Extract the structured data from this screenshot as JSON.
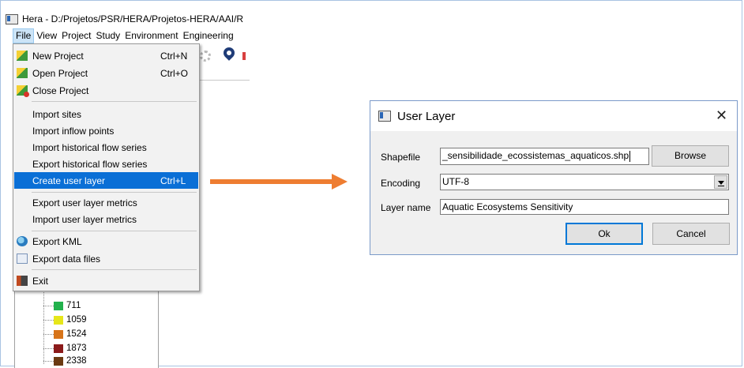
{
  "window": {
    "title": "Hera - D:/Projetos/PSR/HERA/Projetos-HERA/AAI/R"
  },
  "menubar": {
    "items": [
      "File",
      "View",
      "Project",
      "Study",
      "Environment",
      "Engineering"
    ]
  },
  "file_menu": {
    "items": [
      {
        "label": "New Project",
        "shortcut": "Ctrl+N",
        "icon": "new-project-icon"
      },
      {
        "label": "Open Project",
        "shortcut": "Ctrl+O",
        "icon": "open-project-icon"
      },
      {
        "label": "Close Project",
        "shortcut": "",
        "icon": "close-project-icon"
      },
      {
        "label": "Import sites",
        "shortcut": ""
      },
      {
        "label": "Import inflow points",
        "shortcut": ""
      },
      {
        "label": "Import historical flow series",
        "shortcut": ""
      },
      {
        "label": "Export historical flow series",
        "shortcut": ""
      },
      {
        "label": "Create user layer",
        "shortcut": "Ctrl+L",
        "highlighted": true
      },
      {
        "label": "Export user layer metrics",
        "shortcut": ""
      },
      {
        "label": "Import user layer metrics",
        "shortcut": ""
      },
      {
        "label": "Export KML",
        "shortcut": "",
        "icon": "globe-icon"
      },
      {
        "label": "Export data files",
        "shortcut": "",
        "icon": "export-files-icon"
      },
      {
        "label": "Exit",
        "shortcut": "",
        "icon": "exit-icon"
      }
    ]
  },
  "legend": {
    "items": [
      {
        "label": "711",
        "color": "#22b14c"
      },
      {
        "label": "1059",
        "color": "#e6e61a"
      },
      {
        "label": "1524",
        "color": "#d7741a"
      },
      {
        "label": "1873",
        "color": "#8b1a1a"
      },
      {
        "label": "2338",
        "color": "#6b3a12"
      }
    ]
  },
  "dialog": {
    "title": "User Layer",
    "shapefile_label": "Shapefile",
    "shapefile_value": "_sensibilidade_ecossistemas_aquaticos.shp",
    "browse_label": "Browse",
    "encoding_label": "Encoding",
    "encoding_value": "UTF-8",
    "layer_name_label": "Layer name",
    "layer_name_value": "Aquatic Ecosystems Sensitivity",
    "ok_label": "Ok",
    "cancel_label": "Cancel",
    "close_glyph": "✕"
  },
  "colors": {
    "highlight": "#0a6fd6",
    "arrow": "#ee7d31"
  }
}
